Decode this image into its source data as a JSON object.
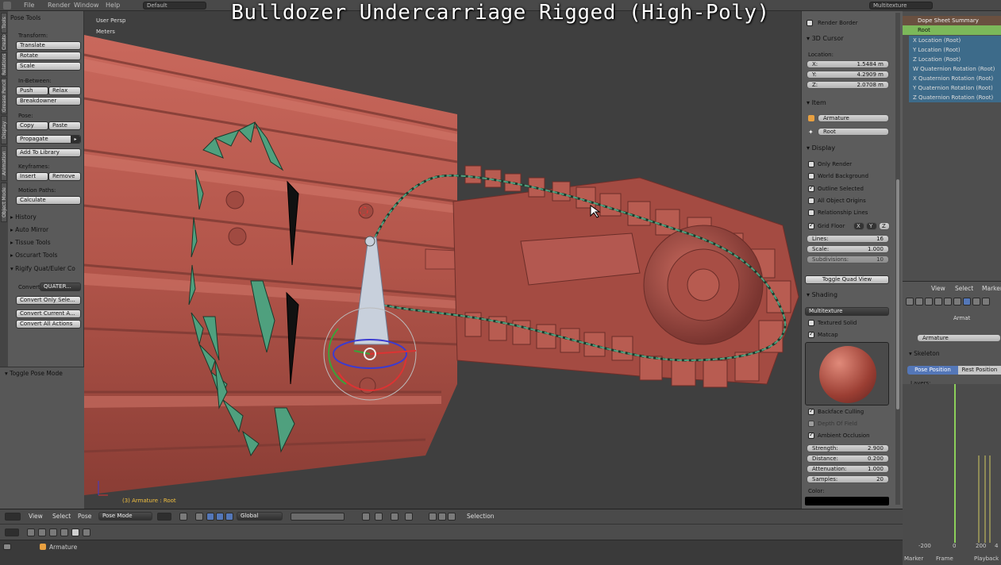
{
  "top_menu": {
    "file": "File",
    "render": "Render",
    "window": "Window",
    "help": "Help",
    "screen_layout": "Default",
    "render_engine": "Multitexture"
  },
  "video_title": "Bulldozer Undercarriage Rigged (High-Poly)",
  "vertical_tabs": [
    "Tools",
    "Create",
    "Relations",
    "Animation",
    "Physics",
    "Grease Pencil",
    "Display",
    "Animation",
    "Object Mode"
  ],
  "tools_panel": {
    "header": "Pose Tools",
    "transform_label": "Transform:",
    "translate": "Translate",
    "rotate": "Rotate",
    "scale": "Scale",
    "in_between_label": "In-Between:",
    "push": "Push",
    "relax": "Relax",
    "breakdowner": "Breakdowner",
    "pose_label": "Pose:",
    "copy": "Copy",
    "paste": "Paste",
    "propagate": "Propagate",
    "add_to_library": "Add To Library",
    "keyframes_label": "Keyframes:",
    "insert": "Insert",
    "remove": "Remove",
    "motion_paths_label": "Motion Paths:",
    "calculate": "Calculate",
    "panels": [
      "History",
      "Auto Mirror",
      "Tissue Tools",
      "Oscurart Tools",
      "Rigify Quat/Euler Co"
    ],
    "convert_label": "Convert",
    "convert_value": "QUATER...",
    "convert_only_selected": "Convert Only Sele...",
    "convert_current_action": "Convert Current A...",
    "convert_all_actions": "Convert All Actions"
  },
  "operator_panel": {
    "header": "Toggle Pose Mode"
  },
  "viewport": {
    "view_label": "User Persp",
    "units_label": "Meters",
    "status": "(3) Armature : Root"
  },
  "properties_panel": {
    "render_border": "Render Border",
    "cursor_header": "3D Cursor",
    "location_label": "Location:",
    "x_label": "X:",
    "x_value": "1.5484 m",
    "y_label": "Y:",
    "y_value": "4.2909 m",
    "z_label": "Z:",
    "z_value": "2.0708 m",
    "item_header": "Item",
    "object_name": "Armature",
    "bone_name": "Root",
    "display_header": "Display",
    "only_render": "Only Render",
    "world_background": "World Background",
    "outline_selected": "Outline Selected",
    "all_object_origins": "All Object Origins",
    "relationship_lines": "Relationship Lines",
    "grid_floor": "Grid Floor",
    "axis_x": "X",
    "axis_y": "Y",
    "axis_z": "Z",
    "lines_label": "Lines:",
    "lines_value": "16",
    "scale_label": "Scale:",
    "scale_value": "1.000",
    "subdivisions_label": "Subdivisions:",
    "subdivisions_value": "10",
    "toggle_quad_view": "Toggle Quad View",
    "shading_header": "Shading",
    "shading_mode": "Multitexture",
    "textured_solid": "Textured Solid",
    "matcap": "Matcap",
    "backface_culling": "Backface Culling",
    "depth_of_field": "Depth Of Field",
    "ambient_occlusion": "Ambient Occlusion",
    "strength_label": "Strength:",
    "strength_value": "2.900",
    "distance_label": "Distance:",
    "distance_value": "0.200",
    "attenuation_label": "Attenuation:",
    "attenuation_value": "1.000",
    "samples_label": "Samples:",
    "samples_value": "20",
    "color_label": "Color:"
  },
  "outliner": {
    "header": "Dope Sheet Summary",
    "rows": [
      "Root",
      "X Location (Root)",
      "Y Location (Root)",
      "Z Location (Root)",
      "W Quaternion Rotation (Root)",
      "X Quaternion Rotation (Root)",
      "Y Quaternion Rotation (Root)",
      "Z Quaternion Rotation (Root)"
    ]
  },
  "props2": {
    "view": "View",
    "select": "Select",
    "marker": "Marker",
    "armature_tab": "Armat",
    "armature_field": "Armature",
    "skeleton_header": "Skeleton",
    "pose_position": "Pose Position",
    "rest_position": "Rest Position",
    "layers_label": "Layers:"
  },
  "timeline": {
    "ticks": [
      "-200",
      "0",
      "200",
      "4"
    ],
    "marker": "Marker",
    "frame": "Frame",
    "playback": "Playback"
  },
  "header3d": {
    "view": "View",
    "select": "Select",
    "pose": "Pose",
    "mode": "Pose Mode",
    "orientation": "Global",
    "selection": "Selection"
  },
  "bottom": {
    "object": "Armature"
  },
  "colors": {
    "bulldozer": "#b5564d",
    "bone_green": "#4fa07e",
    "selected_blue": "#5477b8"
  }
}
